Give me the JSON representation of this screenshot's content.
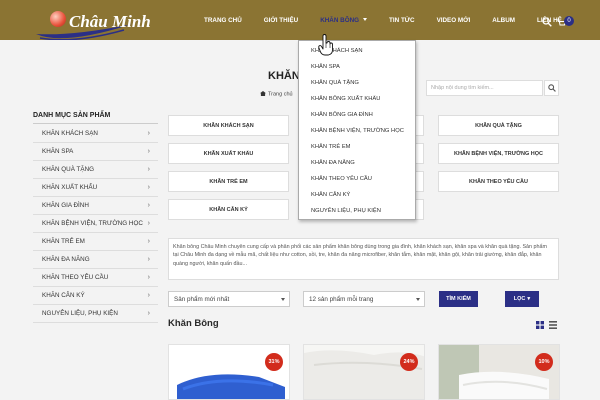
{
  "brand": {
    "name": "Châu Minh"
  },
  "nav": {
    "items": [
      "Trang chủ",
      "Giới thiệu",
      "Khăn bông",
      "Tin tức",
      "Video mới",
      "Album",
      "Liên hệ"
    ],
    "cart_count": "0"
  },
  "dropdown": {
    "items": [
      "Khăn khách sạn",
      "Khăn spa",
      "Khăn quà tặng",
      "Khăn bông xuất khẩu",
      "Khăn bông gia đình",
      "Khăn bệnh viện, trường học",
      "Khăn trẻ em",
      "Khăn đa năng",
      "Khăn theo yêu cầu",
      "Khăn cân ký",
      "Nguyên liệu, phụ kiện"
    ]
  },
  "search": {
    "placeholder": "Nhập nội dung tìm kiếm..."
  },
  "page": {
    "title": "KHĂN",
    "breadcrumb": "Trang chủ"
  },
  "sidebar": {
    "title": "Danh mục sản phẩm",
    "items": [
      "Khăn khách sạn",
      "Khăn spa",
      "Khăn quà tặng",
      "Khăn xuất khẩu",
      "Khăn gia đình",
      "Khăn bệnh viện, trường học",
      "Khăn trẻ em",
      "Khăn đa năng",
      "Khăn theo yêu cầu",
      "Khăn cân ký",
      "Nguyên liệu, phụ kiện"
    ]
  },
  "categories": {
    "col1": [
      "Khăn khách sạn",
      "Khăn xuất khẩu",
      "Khăn trẻ em",
      "Khăn cân ký"
    ],
    "col4": [
      "Khăn quà tặng",
      "Khăn bệnh viện, trường học",
      "Khăn theo yêu cầu"
    ]
  },
  "description": "Khăn bông Châu Minh chuyên cung cấp và phân phối các sản phẩm khăn bông dùng trong gia đình, khăn khách sạn, khăn spa và khăn quà tặng. Sản phẩm tại Châu Minh đa dạng về mẫu mã, chất liệu như cotton, sồi, tre, khăn đa năng microfiber, khăn tắm, khăn mặt, khăn gội, khăn trải giường, khăn đắp, khăn quàng người, khăn quấn đầu...",
  "filters": {
    "sort": "Sản phẩm mới nhất",
    "per_page": "12 sản phẩm mỗi trang",
    "search_button": "Tìm kiếm",
    "filter_button": "Lọc"
  },
  "section": {
    "title": "Khăn Bông"
  },
  "products": [
    {
      "discount": "31%"
    },
    {
      "discount": "24%"
    },
    {
      "discount": "10%"
    }
  ],
  "colors": {
    "header": "#8b7433",
    "accent": "#2b2f86",
    "discount": "#d22c1c"
  }
}
